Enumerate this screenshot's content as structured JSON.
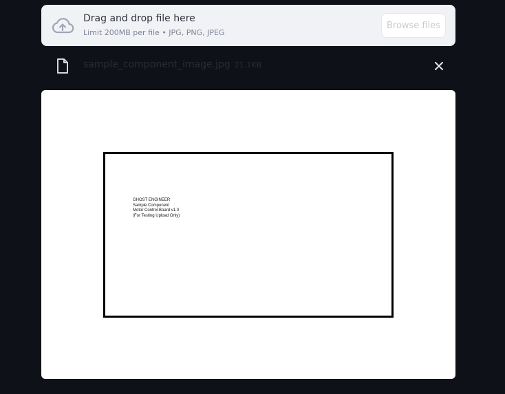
{
  "uploader": {
    "title": "Drag and drop file here",
    "subtitle": "Limit 200MB per file • JPG, PNG, JPEG",
    "browse_label": "Browse files",
    "icon": "cloud-upload-icon"
  },
  "file": {
    "name": "sample_component_image.jpg",
    "size": "21.1KB",
    "icon": "file-icon",
    "remove_icon": "close-icon"
  },
  "preview": {
    "lines": [
      "GHOST ENGINEER",
      "Sample Component",
      "Motor Control Board v1.0",
      "(For Testing Upload Only)"
    ]
  },
  "colors": {
    "background": "#0e1117",
    "dropzone": "#f0f2f6",
    "text_primary": "#31333f",
    "text_secondary": "#808495"
  }
}
